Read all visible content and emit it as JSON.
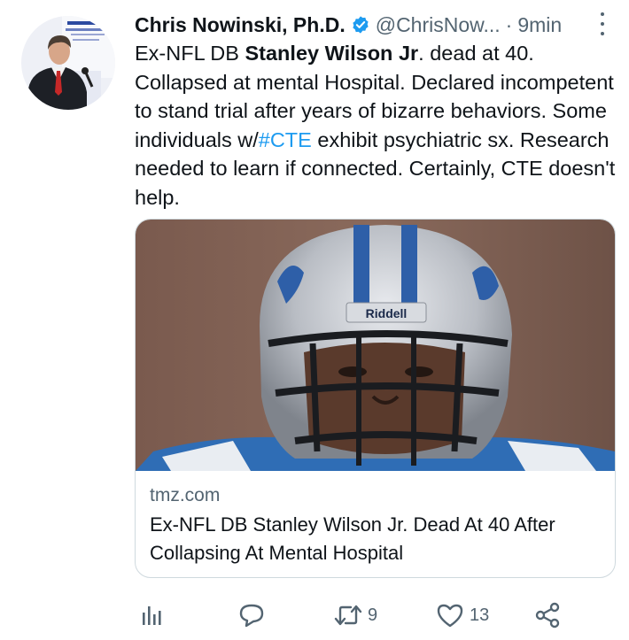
{
  "tweet": {
    "author_name": "Chris Nowinski, Ph.D.",
    "handle": "@ChrisNow...",
    "separator": "·",
    "time": "9min",
    "text": {
      "p1": "Ex-NFL DB ",
      "bold": "Stanley Wilson Jr",
      "p2": ". dead at 40. Collapsed at mental Hospital. Declared incompetent to stand trial after years of bizarre behaviors. Some individuals w/",
      "hashtag": "#CTE",
      "p3": " exhibit psychiatric sx. Research needed to learn if connected. Certainly, CTE doesn't help."
    }
  },
  "card": {
    "helmet_brand": "Riddell",
    "domain": "tmz.com",
    "title": "Ex-NFL DB Stanley Wilson Jr. Dead At 40 After Collapsing At Mental Hospital"
  },
  "actions": {
    "retweets": "9",
    "likes": "13"
  },
  "colors": {
    "text": "#0f1419",
    "muted": "#536471",
    "link": "#1d9bf0",
    "verified": "#1d9bf0",
    "border": "#cfd9de"
  },
  "icons": [
    "analytics-icon",
    "reply-icon",
    "retweet-icon",
    "like-icon",
    "share-icon",
    "verified-badge-icon",
    "more-options-icon"
  ]
}
